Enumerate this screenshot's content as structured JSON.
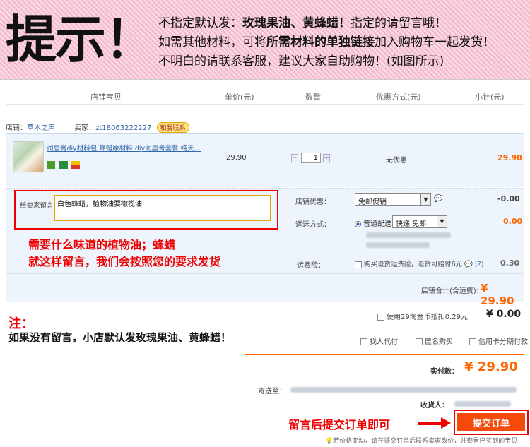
{
  "banner": {
    "big_text": "提示！",
    "line1_a": "不指定默认发：",
    "line1_b": "玫瑰果油、黄蜂蜡！",
    "line1_c": "指定的请留言哦！",
    "line2_a": "如需其他材料，可将",
    "line2_b": "所需材料的单独链接",
    "line2_c": "加入购物车一起发货！",
    "line3": "不明白的请联系客服，建议大家自助购物！(如图所示)"
  },
  "table_header": [
    "店铺宝贝",
    "单价(元)",
    "数量",
    "优惠方式(元)",
    "小计(元)"
  ],
  "shop": {
    "label": "店铺：",
    "name": "草木之声",
    "seller_label": "卖家：",
    "seller": "zt18063222227",
    "contact": "和我联系"
  },
  "item": {
    "name": "润唇膏diy材料包 蜂蜡原材料 diy润唇膏套餐 纯天…",
    "price": "29.90",
    "qty": "1",
    "discount": "无优惠",
    "subtotal": "29.90"
  },
  "message": {
    "label": "给卖家留言：",
    "value": "白色蜂蜡，植物油要橄榄油"
  },
  "instruction": {
    "line1": "需要什么味道的植物油；蜂蜡",
    "line2": "就这样留言，我们会按照您的要求发货"
  },
  "options": {
    "shop_promo_label": "店铺优惠：",
    "shop_promo_value": "免邮促销",
    "shop_promo_amount": "-0.00",
    "ship_label": "运送方式：",
    "ship_radio": "普通配送",
    "ship_select": "快递 免邮",
    "ship_amount": "0.00",
    "insurance_label": "运费险：",
    "insurance_text": "购买退货运费险，退货可赔付6元",
    "insurance_help": "[?]",
    "insurance_amount": "0.30",
    "shop_total_label": "店铺合计(含运费)：",
    "shop_total_value": "¥ 29.90"
  },
  "coin": {
    "text": "使用29淘金币抵扣0.29元",
    "amount": "¥ 0.00"
  },
  "note": {
    "title": "注：",
    "text": "如果没有留言，小店默认发玫瑰果油、黄蜂蜡！"
  },
  "extras": [
    "找人代付",
    "匿名购买",
    "信用卡分期付款"
  ],
  "pay": {
    "actual_label": "实付款：",
    "actual_value": "¥ 29.90",
    "address_label": "寄送至：",
    "receiver_label": "收货人："
  },
  "submit": {
    "hint": "留言后提交订单即可",
    "button": "提交订单",
    "footnote": "若价格变动，请在提交订单后联系卖家改价，并查看已买到的宝贝"
  },
  "colors": {
    "accent": "#f60",
    "red": "#e00",
    "link": "#3366aa"
  }
}
